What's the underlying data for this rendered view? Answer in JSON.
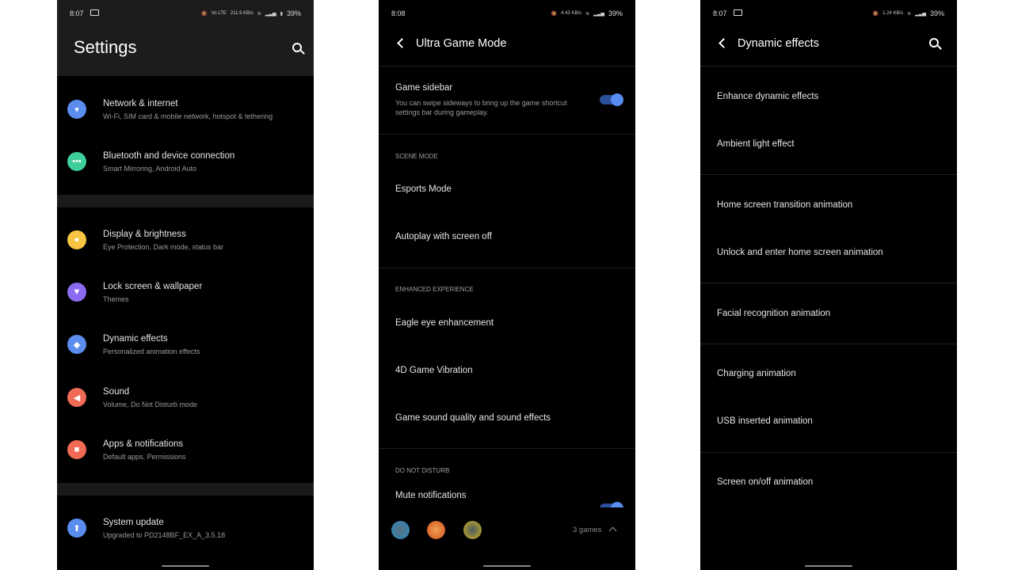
{
  "settings": {
    "status": {
      "time": "8:07",
      "speed": "211.9 KB/s",
      "net": "Vo LTE",
      "battery": "39%"
    },
    "title": "Settings",
    "items": [
      {
        "label": "Network & internet",
        "sub": "Wi-Fi, SIM card & mobile network, hotspot & tethering",
        "icon": "wifi-icon",
        "color": "#5b8def",
        "glyph": "▾"
      },
      {
        "label": "Bluetooth and device connection",
        "sub": "Smart Mirroring, Android Auto",
        "icon": "more-dots-icon",
        "color": "#3ecf9a",
        "glyph": "•••"
      },
      {
        "label": "Display & brightness",
        "sub": "Eye Protection, Dark mode, status bar",
        "icon": "brightness-icon",
        "color": "#f7c443",
        "glyph": "●"
      },
      {
        "label": "Lock screen & wallpaper",
        "sub": "Themes",
        "icon": "brush-icon",
        "color": "#8b6cf0",
        "glyph": "▼"
      },
      {
        "label": "Dynamic effects",
        "sub": "Personalized animation effects",
        "icon": "layers-icon",
        "color": "#5b8def",
        "glyph": "◆"
      },
      {
        "label": "Sound",
        "sub": "Volume, Do Not Disturb mode",
        "icon": "speaker-icon",
        "color": "#f06a55",
        "glyph": "◀"
      },
      {
        "label": "Apps & notifications",
        "sub": "Default apps, Permissions",
        "icon": "apps-icon",
        "color": "#f06a55",
        "glyph": "■"
      },
      {
        "label": "System update",
        "sub": "Upgraded to PD2148BF_EX_A_3.5.18",
        "icon": "arrow-up-icon",
        "color": "#5b8def",
        "glyph": "⬆"
      }
    ]
  },
  "game": {
    "status": {
      "time": "8:08",
      "speed": "4.43 KB/s",
      "battery": "39%"
    },
    "title": "Ultra Game Mode",
    "sidebar": {
      "label": "Game sidebar",
      "sub": "You can swipe sideways to bring up the game shortcut settings bar during gameplay.",
      "on": true
    },
    "sections": [
      {
        "label": "Scene mode",
        "items": [
          "Esports Mode",
          "Autoplay with screen off"
        ]
      },
      {
        "label": "Enhanced experience",
        "items": [
          "Eagle eye enhancement",
          "4D Game Vibration",
          "Game sound quality and sound effects"
        ]
      },
      {
        "label": "Do not disturb",
        "items": [
          "Mute notifications"
        ]
      }
    ],
    "games_count": "3 games"
  },
  "effects": {
    "status": {
      "time": "8:07",
      "speed": "1.24 KB/s",
      "battery": "39%"
    },
    "title": "Dynamic effects",
    "items": [
      "Enhance dynamic effects",
      "Ambient light effect",
      "Home screen transition animation",
      "Unlock and enter home screen animation",
      "Facial recognition animation",
      "Charging animation",
      "USB inserted animation",
      "Screen on/off animation"
    ]
  }
}
